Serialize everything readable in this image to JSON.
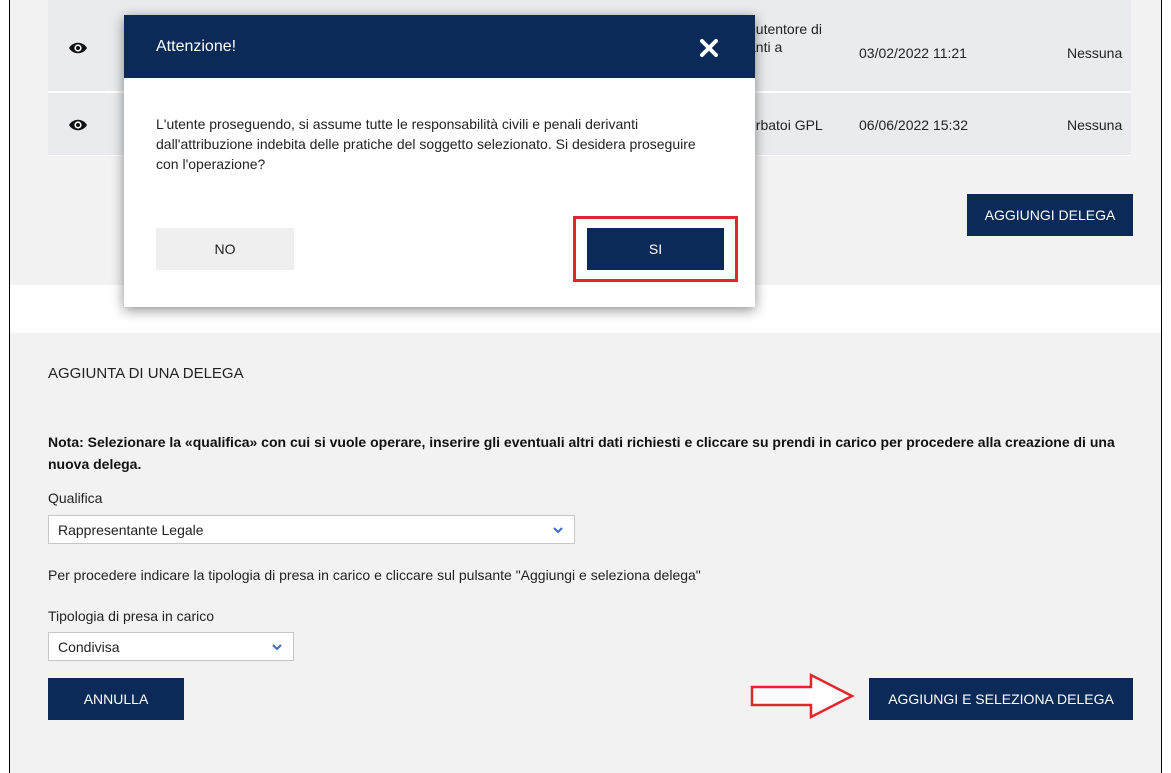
{
  "table": {
    "rows": [
      {
        "description": "nutentore di\nanti a",
        "date": "03/02/2022 11:21",
        "status": "Nessuna"
      },
      {
        "description": "erbatoi GPL",
        "date": "06/06/2022 15:32",
        "status": "Nessuna"
      }
    ],
    "add_delega_label": "AGGIUNGI DELEGA"
  },
  "modal": {
    "title": "Attenzione!",
    "message": "L'utente proseguendo, si assume tutte le responsabilità civili e penali derivanti dall'attribuzione indebita delle pratiche del soggetto selezionato. Si desidera proseguire con l'operazione?",
    "no_label": "NO",
    "yes_label": "SI"
  },
  "form": {
    "section_title": "AGGIUNTA DI UNA DELEGA",
    "note": "Nota: Selezionare la «qualifica» con cui si vuole operare, inserire gli eventuali altri dati richiesti e cliccare su prendi in carico per procedere alla creazione di una nuova delega.",
    "qualifica_label": "Qualifica",
    "qualifica_value": "Rappresentante Legale",
    "instruction": "Per procedere indicare la tipologia di presa in carico e cliccare sul pulsante \"Aggiungi e seleziona delega\"",
    "tipologia_label": "Tipologia di presa in carico",
    "tipologia_value": "Condivisa",
    "cancel_label": "ANNULLA",
    "submit_label": "AGGIUNGI E SELEZIONA DELEGA"
  },
  "colors": {
    "primary": "#0b2a58",
    "highlight": "#e3262d",
    "panel": "#f2f2f2"
  },
  "icons": [
    "eye-icon",
    "close-icon",
    "chevron-down-icon",
    "arrow-right-icon"
  ]
}
